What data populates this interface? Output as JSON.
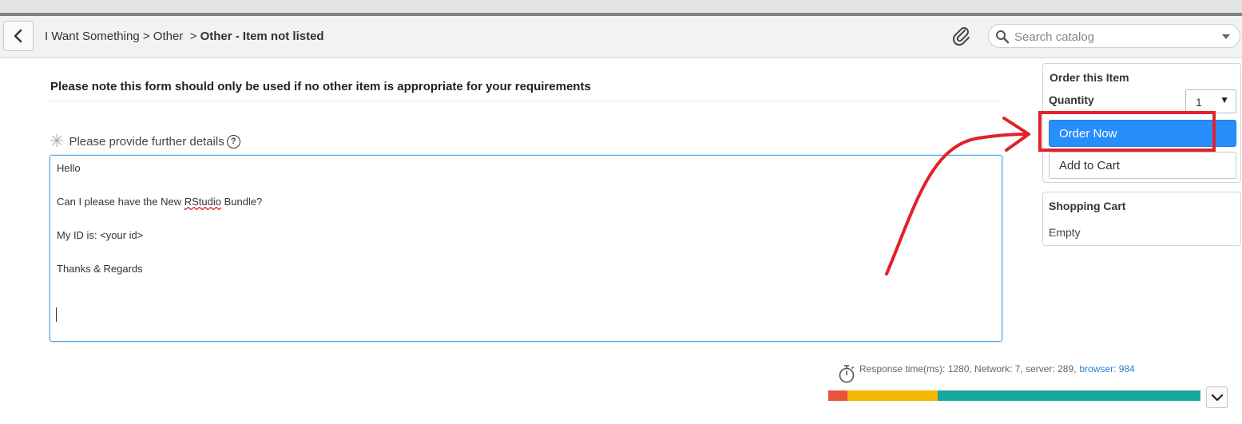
{
  "header": {
    "breadcrumb": {
      "item1": "I Want Something",
      "sep1": ">",
      "item2": "Other",
      "sep2": ">",
      "current": "Other - Item not listed"
    },
    "search": {
      "placeholder": "Search catalog"
    }
  },
  "form": {
    "notice": "Please note this form should only be used if no other item is appropriate for your requirements",
    "field_label": "Please provide further details",
    "help_glyph": "?",
    "details_lines": {
      "l1": "Hello",
      "l2": "",
      "l3_before": "Can I please have the New ",
      "l3_spell": "RStudio",
      "l3_after": " Bundle?",
      "l4": "",
      "l5": "My ID is: <your id>",
      "l6": "",
      "l7": "Thanks & Regards"
    }
  },
  "order_panel": {
    "title": "Order this Item",
    "quantity_label": "Quantity",
    "quantity_value": "1",
    "order_now": "Order Now",
    "add_to_cart": "Add to Cart"
  },
  "cart_panel": {
    "title": "Shopping Cart",
    "status": "Empty"
  },
  "performance": {
    "text": "Response time(ms): 1280, Network: 7, server: 289,",
    "browser_link": "browser: 984",
    "bar_segments": [
      {
        "label": "network",
        "color": "#e4553b",
        "fraction": 0.052
      },
      {
        "label": "server",
        "color": "#f5b800",
        "fraction": 0.243
      },
      {
        "label": "browser",
        "color": "#17a89c",
        "fraction": 0.705
      }
    ]
  },
  "colors": {
    "accent": "#278efc",
    "annotation": "#e2212a",
    "link": "#2a7fd4"
  },
  "icons": {
    "back": "chevron-left-icon",
    "attach": "paperclip-icon",
    "search": "magnifier-icon",
    "help": "question-circle-icon",
    "stopwatch": "stopwatch-icon",
    "expand": "chevron-down-icon"
  }
}
